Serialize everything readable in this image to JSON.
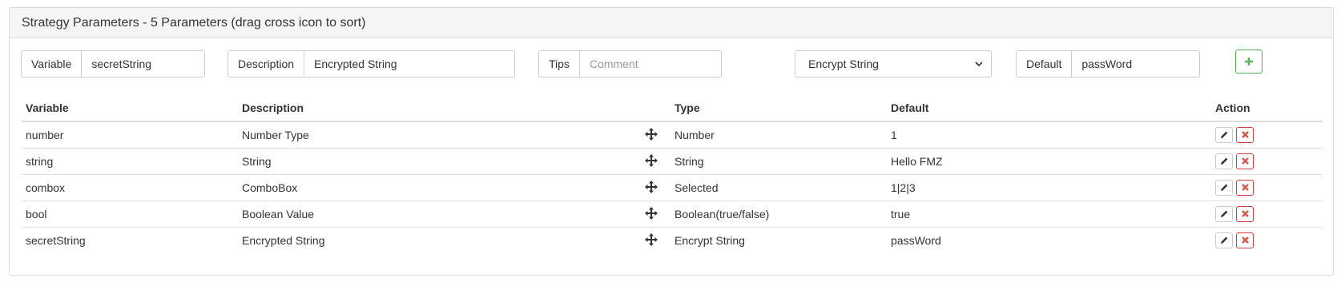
{
  "panel": {
    "title": "Strategy Parameters - 5 Parameters (drag cross icon to sort)"
  },
  "form": {
    "variable": {
      "label": "Variable",
      "value": "secretString"
    },
    "description": {
      "label": "Description",
      "value": "Encrypted String"
    },
    "tips": {
      "label": "Tips",
      "value": "",
      "placeholder": "Comment"
    },
    "type_select": {
      "selected": "Encrypt String"
    },
    "default": {
      "label": "Default",
      "value": "passWord"
    },
    "add_icon": "plus-icon"
  },
  "table": {
    "headers": {
      "variable": "Variable",
      "description": "Description",
      "type": "Type",
      "default": "Default",
      "action": "Action"
    },
    "rows": [
      {
        "variable": "number",
        "description": "Number Type",
        "type": "Number",
        "default": "1"
      },
      {
        "variable": "string",
        "description": "String",
        "type": "String",
        "default": "Hello FMZ"
      },
      {
        "variable": "combox",
        "description": "ComboBox",
        "type": "Selected",
        "default": "1|2|3"
      },
      {
        "variable": "bool",
        "description": "Boolean Value",
        "type": "Boolean(true/false)",
        "default": "true"
      },
      {
        "variable": "secretString",
        "description": "Encrypted String",
        "type": "Encrypt String",
        "default": "passWord"
      }
    ]
  },
  "icons": {
    "drag": "move-cross-icon",
    "edit": "pencil-icon",
    "delete": "close-icon"
  },
  "colors": {
    "add_green": "#5cb85c",
    "delete_red": "#d9534f",
    "heading_bg": "#f5f5f5"
  }
}
